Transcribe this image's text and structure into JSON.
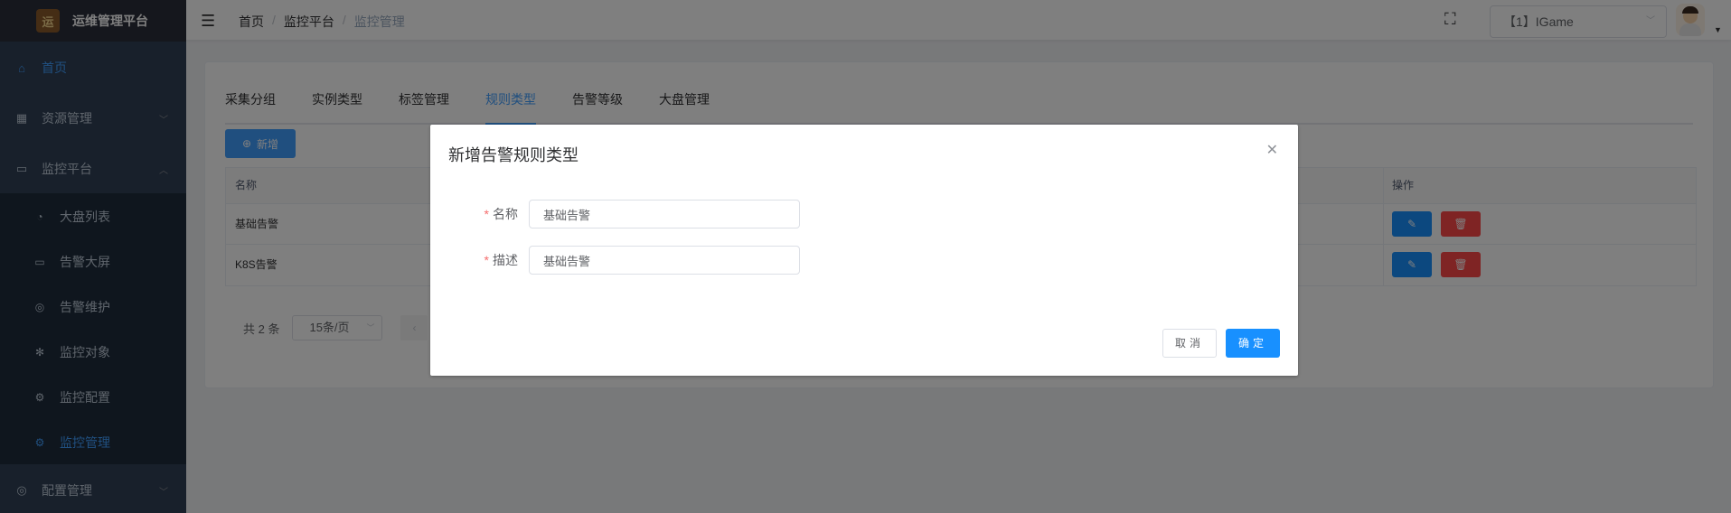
{
  "app": {
    "title": "运维管理平台",
    "logo_text": "运"
  },
  "sidebar": {
    "items": [
      {
        "label": "首页",
        "icon": "home-icon"
      },
      {
        "label": "资源管理",
        "icon": "resource-icon"
      },
      {
        "label": "监控平台",
        "icon": "monitor-icon"
      },
      {
        "label": "配置管理",
        "icon": "config-icon"
      }
    ],
    "subitems": [
      {
        "label": "大盘列表",
        "icon": "dashboard-icon"
      },
      {
        "label": "告警大屏",
        "icon": "screen-icon"
      },
      {
        "label": "告警维护",
        "icon": "maintenance-icon"
      },
      {
        "label": "监控对象",
        "icon": "target-icon"
      },
      {
        "label": "监控配置",
        "icon": "setting-icon"
      },
      {
        "label": "监控管理",
        "icon": "manage-icon"
      }
    ]
  },
  "breadcrumb": [
    "首页",
    "监控平台",
    "监控管理"
  ],
  "breadcrumb_sep": "/",
  "header": {
    "tenant": "【1】IGame"
  },
  "tabs": [
    "采集分组",
    "实例类型",
    "标签管理",
    "规则类型",
    "告警等级",
    "大盘管理"
  ],
  "active_tab": "规则类型",
  "toolbar": {
    "add_label": "新增"
  },
  "table": {
    "columns": [
      "名称",
      "操作"
    ],
    "rows": [
      {
        "name": "基础告警"
      },
      {
        "name": "K8S告警"
      }
    ]
  },
  "pagination": {
    "total_text": "共 2 条",
    "page_size": "15条/页"
  },
  "dialog": {
    "title": "新增告警规则类型",
    "required_mark": "*",
    "fields": [
      {
        "label": "名称",
        "value": "基础告警"
      },
      {
        "label": "描述",
        "value": "基础告警"
      }
    ],
    "cancel_label": "取消",
    "ok_label": "确定"
  },
  "colors": {
    "primary": "#1890ff",
    "danger": "#ff4949",
    "sidebar_bg": "#304156",
    "active_menu": "#409eff"
  }
}
